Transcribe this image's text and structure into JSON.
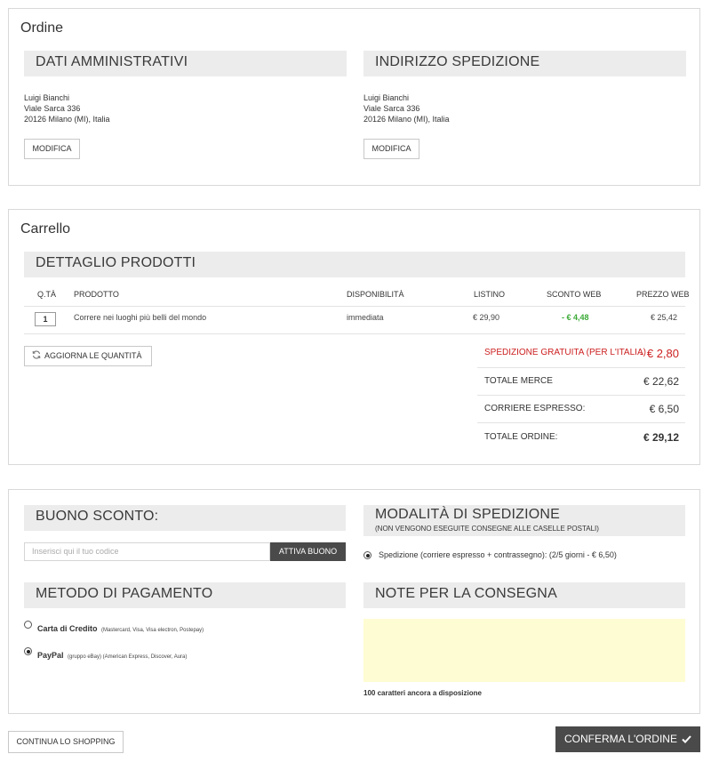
{
  "order": {
    "title": "Ordine",
    "admin": {
      "heading": "DATI AMMINISTRATIVI",
      "name": "Luigi Bianchi",
      "street": "Viale Sarca 336",
      "city": "20126 Milano (MI), Italia",
      "edit_label": "MODIFICA"
    },
    "shipping": {
      "heading": "INDIRIZZO SPEDIZIONE",
      "name": "Luigi Bianchi",
      "street": "Viale Sarca 336",
      "city": "20126 Milano (MI), Italia",
      "edit_label": "MODIFICA"
    }
  },
  "cart": {
    "title": "Carrello",
    "heading": "DETTAGLIO PRODOTTI",
    "columns": [
      "Q.TÀ",
      "PRODOTTO",
      "DISPONIBILITÀ",
      "LISTINO",
      "SCONTO WEB",
      "PREZZO WEB"
    ],
    "rows": [
      {
        "qty": "1",
        "product": "Correre nei luoghi più belli del mondo",
        "availability": "immediata",
        "list_price": "€ 29,90",
        "discount": "- € 4,48",
        "web_price": "€ 25,42"
      }
    ],
    "update_label": "AGGIORNA LE QUANTITÀ",
    "totals": {
      "free_shipping_label": "SPEDIZIONE GRATUITA (PER L'ITALIA)",
      "free_shipping_value": "- € 2,80",
      "goods_label": "TOTALE MERCE",
      "goods_value": "€ 22,62",
      "courier_label": "CORRIERE ESPRESSO:",
      "courier_value": "€ 6,50",
      "order_label": "TOTALE ORDINE:",
      "order_value": "€ 29,12"
    }
  },
  "voucher": {
    "heading": "BUONO SCONTO:",
    "placeholder": "Inserisci qui il tuo codice",
    "button_label": "ATTIVA BUONO"
  },
  "shipping_method": {
    "heading": "MODALITÀ DI SPEDIZIONE",
    "subheading": "(NON VENGONO ESEGUITE CONSEGNE ALLE CASELLE POSTALI)",
    "option": "Spedizione (corriere espresso + contrassegno): (2/5 giorni - € 6,50)"
  },
  "payment": {
    "heading": "METODO DI PAGAMENTO",
    "options": [
      {
        "name": "Carta di Credito",
        "detail": "(Mastercard, Visa, Visa electron, Postepay)",
        "selected": false
      },
      {
        "name": "PayPal",
        "detail": "(gruppo eBay) (American Express, Discover, Aura)",
        "selected": true
      }
    ]
  },
  "notes": {
    "heading": "NOTE PER LA CONSEGNA",
    "counter": "100 caratteri ancora a disposizione"
  },
  "footer": {
    "continue_label": "CONTINUA LO SHOPPING",
    "confirm_label": "CONFERMA L'ORDINE"
  },
  "colors": {
    "band": "#ececec",
    "discount_green": "#3aaa35",
    "shipping_red": "#cc1f1f",
    "dark_button": "#4a4a4a",
    "notes_bg": "#fefcd2"
  }
}
